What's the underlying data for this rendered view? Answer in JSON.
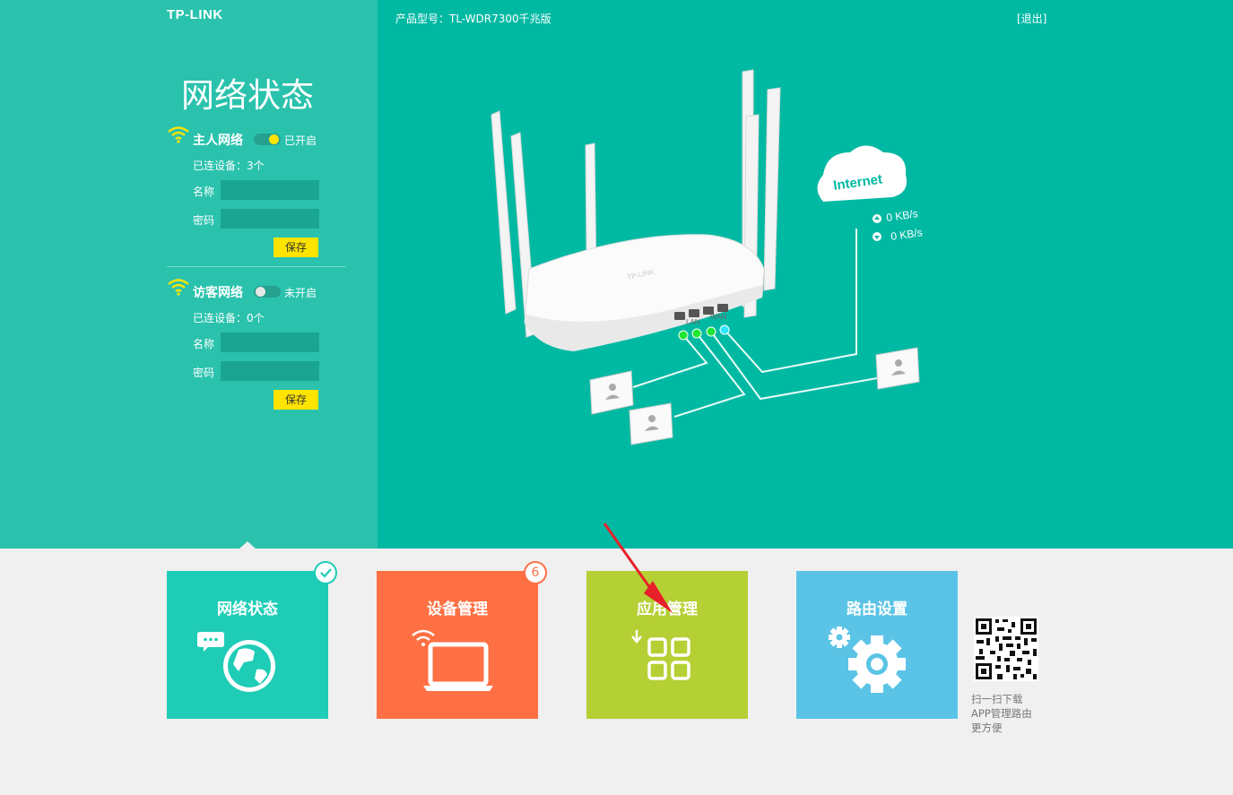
{
  "header": {
    "logo": "TP-LINK",
    "model": "产品型号：TL-WDR7300千兆版",
    "logout": "[退出]"
  },
  "panel": {
    "title": "网络状态",
    "host_network": {
      "label": "主人网络",
      "state": "已开启",
      "devices": "已连设备：3个",
      "name_label": "名称",
      "name_value": "",
      "password_label": "密码",
      "password_value": "",
      "save": "保存"
    },
    "guest_network": {
      "label": "访客网络",
      "state": "未开启",
      "devices": "已连设备：0个",
      "name_label": "名称",
      "name_value": "",
      "password_label": "密码",
      "password_value": "",
      "save": "保存"
    }
  },
  "diagram": {
    "internet": "Internet",
    "upload": "0 KB/s",
    "download": "0 KB/s",
    "lan": "LAN",
    "wan": "WAN",
    "brand": "TP-LINK"
  },
  "tiles": [
    {
      "label": "网络状态",
      "color": "#1fcdb7",
      "icon": "globe-chat-icon"
    },
    {
      "label": "设备管理",
      "color": "#fe7044",
      "icon": "laptop-wifi-icon",
      "badge": "6"
    },
    {
      "label": "应用管理",
      "color": "#b5d034",
      "icon": "app-grid-icon"
    },
    {
      "label": "路由设置",
      "color": "#5bc4e6",
      "icon": "gear-icon"
    }
  ],
  "qr": {
    "line1": "扫一扫下载",
    "line2": "APP管理路由",
    "line3": "更方便"
  }
}
